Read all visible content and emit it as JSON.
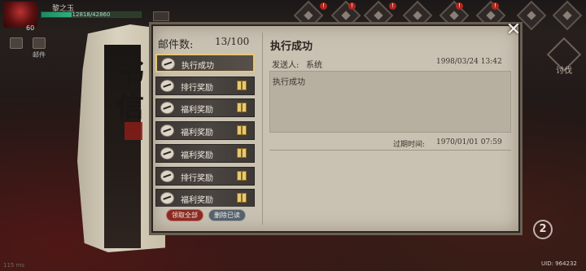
{
  "player": {
    "name": "黎之玉",
    "level": "60",
    "xp_text": "12818/42860",
    "xp_fraction": 0.3
  },
  "side_buttons": [
    "",
    "邮件"
  ],
  "top_icons_badge": "!",
  "right_label": "讨伐",
  "scroll_chars": [
    "书",
    "信"
  ],
  "mailbox": {
    "count_label": "邮件数:",
    "count_value": "13/100",
    "items": [
      {
        "title": "执行成功",
        "has_gift": false,
        "selected": true
      },
      {
        "title": "排行奖励",
        "has_gift": true,
        "selected": false
      },
      {
        "title": "福利奖励",
        "has_gift": true,
        "selected": false
      },
      {
        "title": "福利奖励",
        "has_gift": true,
        "selected": false
      },
      {
        "title": "福利奖励",
        "has_gift": true,
        "selected": false
      },
      {
        "title": "排行奖励",
        "has_gift": true,
        "selected": false
      },
      {
        "title": "福利奖励",
        "has_gift": true,
        "selected": false
      }
    ],
    "claim_all_label": "领取全部",
    "delete_read_label": "删除已读"
  },
  "detail": {
    "title": "执行成功",
    "sender_label": "发送人:",
    "sender_name": "系统",
    "send_date": "1998/03/24 13:42",
    "content": "执行成功",
    "expire_label": "过期时间:",
    "expire_time": "1970/01/01 07:59"
  },
  "corner_number": "2",
  "uid": "UID: 964232",
  "bottom_left": "115 ms"
}
